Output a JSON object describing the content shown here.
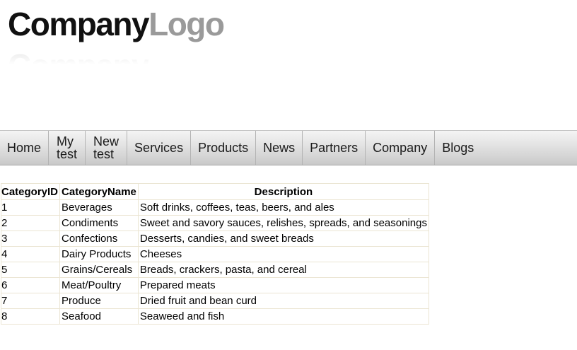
{
  "logo": {
    "part1": "Company",
    "part2": "Logo"
  },
  "nav": {
    "items": [
      {
        "label": "Home"
      },
      {
        "label": "My\ntest"
      },
      {
        "label": "New\ntest"
      },
      {
        "label": "Services"
      },
      {
        "label": "Products"
      },
      {
        "label": "News"
      },
      {
        "label": "Partners"
      },
      {
        "label": "Company"
      },
      {
        "label": "Blogs"
      }
    ]
  },
  "table": {
    "headers": {
      "id": "CategoryID",
      "name": "CategoryName",
      "description": "Description"
    },
    "rows": [
      {
        "id": "1",
        "name": "Beverages",
        "description": "Soft drinks, coffees, teas, beers, and ales"
      },
      {
        "id": "2",
        "name": "Condiments",
        "description": "Sweet and savory sauces, relishes, spreads, and seasonings"
      },
      {
        "id": "3",
        "name": "Confections",
        "description": "Desserts, candies, and sweet breads"
      },
      {
        "id": "4",
        "name": "Dairy Products",
        "description": "Cheeses"
      },
      {
        "id": "5",
        "name": "Grains/Cereals",
        "description": "Breads, crackers, pasta, and cereal"
      },
      {
        "id": "6",
        "name": "Meat/Poultry",
        "description": "Prepared meats"
      },
      {
        "id": "7",
        "name": "Produce",
        "description": "Dried fruit and bean curd"
      },
      {
        "id": "8",
        "name": "Seafood",
        "description": "Seaweed and fish"
      }
    ]
  }
}
